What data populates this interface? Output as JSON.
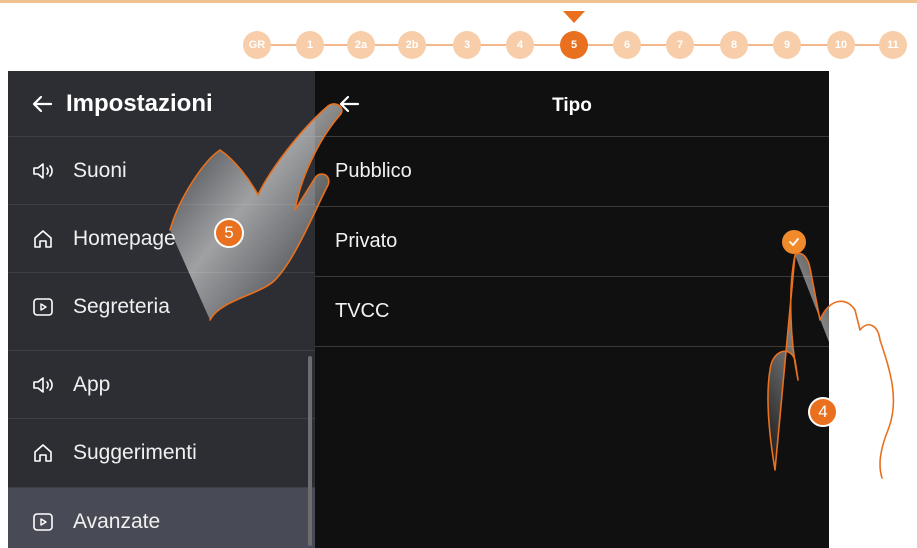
{
  "stepper": {
    "steps": [
      "GR",
      "1",
      "2a",
      "2b",
      "3",
      "4",
      "5",
      "6",
      "7",
      "8",
      "9",
      "10",
      "11"
    ],
    "active_index": 6
  },
  "left_panel": {
    "title": "Impostazioni",
    "items": [
      {
        "label": "Suoni",
        "icon": "speaker-icon"
      },
      {
        "label": "Homepage",
        "icon": "home-icon"
      },
      {
        "label": "Segreteria",
        "icon": "play-box-icon"
      },
      {
        "label": "App",
        "icon": "speaker-icon"
      },
      {
        "label": "Suggerimenti",
        "icon": "home-icon"
      },
      {
        "label": "Avanzate",
        "icon": "play-box-icon",
        "selected": true
      }
    ]
  },
  "right_panel": {
    "title": "Tipo",
    "options": [
      {
        "label": "Pubblico",
        "checked": false
      },
      {
        "label": "Privato",
        "checked": true
      },
      {
        "label": "TVCC",
        "checked": false
      }
    ]
  },
  "callouts": {
    "a": "5",
    "b": "4"
  },
  "colors": {
    "accent": "#e8701f",
    "check": "#f18a2a",
    "panel_left": "#2c2e33",
    "panel_right": "#101010"
  }
}
